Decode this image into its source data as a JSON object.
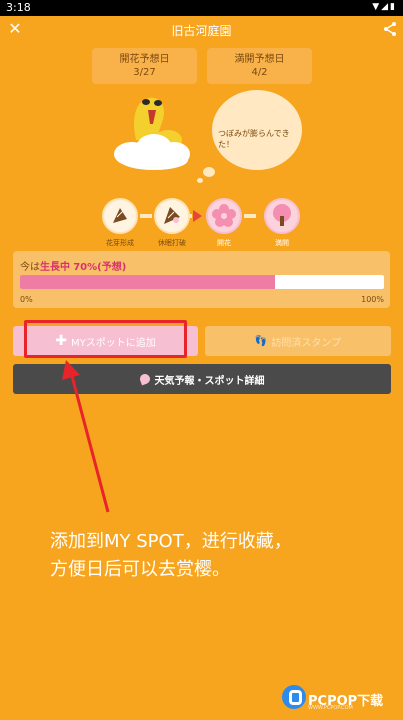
{
  "status_bar": {
    "time": "3:18",
    "icons": [
      "wifi-icon",
      "signal-icon",
      "battery-icon"
    ]
  },
  "header": {
    "title": "旧古河庭園"
  },
  "forecast": {
    "bloom": {
      "label": "開花予想日",
      "value": "3/27"
    },
    "full": {
      "label": "満開予想日",
      "value": "4/2"
    }
  },
  "speech_bubble": "つぼみが膨らんできた！",
  "stages": [
    {
      "label": "花芽形成",
      "state": "done"
    },
    {
      "label": "休眠打破",
      "state": "done"
    },
    {
      "label": "開花",
      "state": "active"
    },
    {
      "label": "満開",
      "state": "future"
    }
  ],
  "progress": {
    "prefix": "今は",
    "status": "生長中",
    "value_text": "70%(予想)",
    "percent": 70,
    "min_label": "0%",
    "max_label": "100%"
  },
  "buttons": {
    "add_myspot": "MYスポットに追加",
    "visited_stamp": "訪問済スタンプ",
    "weather_detail": "天気予報・スポット詳細"
  },
  "annotation": {
    "line1": "添加到MY SPOT，进行收藏，",
    "line2": "方便日后可以去赏樱。"
  },
  "watermark": {
    "name": "PCPOP下载",
    "sub": "WWW.PCPOP.COM"
  },
  "colors": {
    "background": "#F7A41F",
    "progress_fill": "#EE7CA4",
    "highlight": "#E8232A",
    "dark_button": "#4A4A4A"
  }
}
